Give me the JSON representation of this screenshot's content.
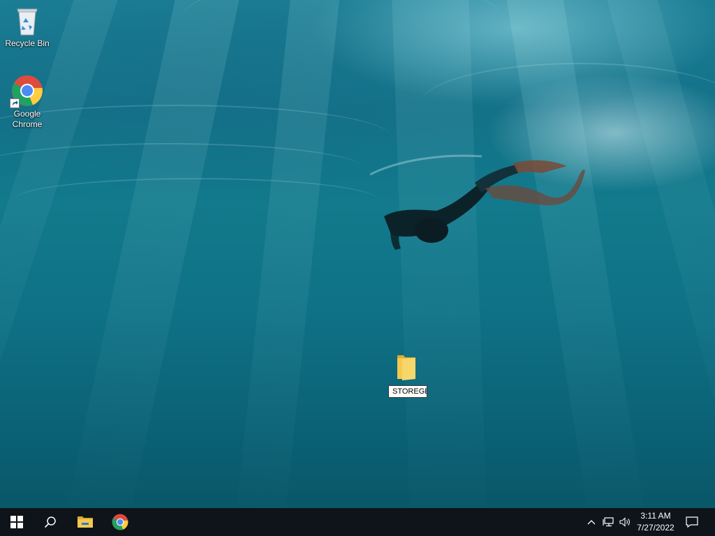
{
  "desktop": {
    "icons": [
      {
        "label": "Recycle Bin",
        "icon": "recycle-bin-icon"
      },
      {
        "label_line1": "Google",
        "label_line2": "Chrome",
        "icon": "chrome-icon",
        "shortcut": true
      }
    ],
    "renaming_folder": {
      "value": "STOREGE",
      "icon": "folder-icon"
    }
  },
  "taskbar": {
    "items": [
      "windows-start-icon",
      "search-icon",
      "file-explorer-icon",
      "chrome-icon"
    ],
    "tray": [
      "chevron-up-icon",
      "network-icon",
      "speaker-icon"
    ],
    "clock": {
      "time": "3:11 AM",
      "date": "7/27/2022"
    },
    "notifications_icon": "action-center-icon"
  },
  "colors": {
    "taskbar": "#0e1419",
    "folder": "#f3c94f",
    "water": "#127a8c"
  }
}
